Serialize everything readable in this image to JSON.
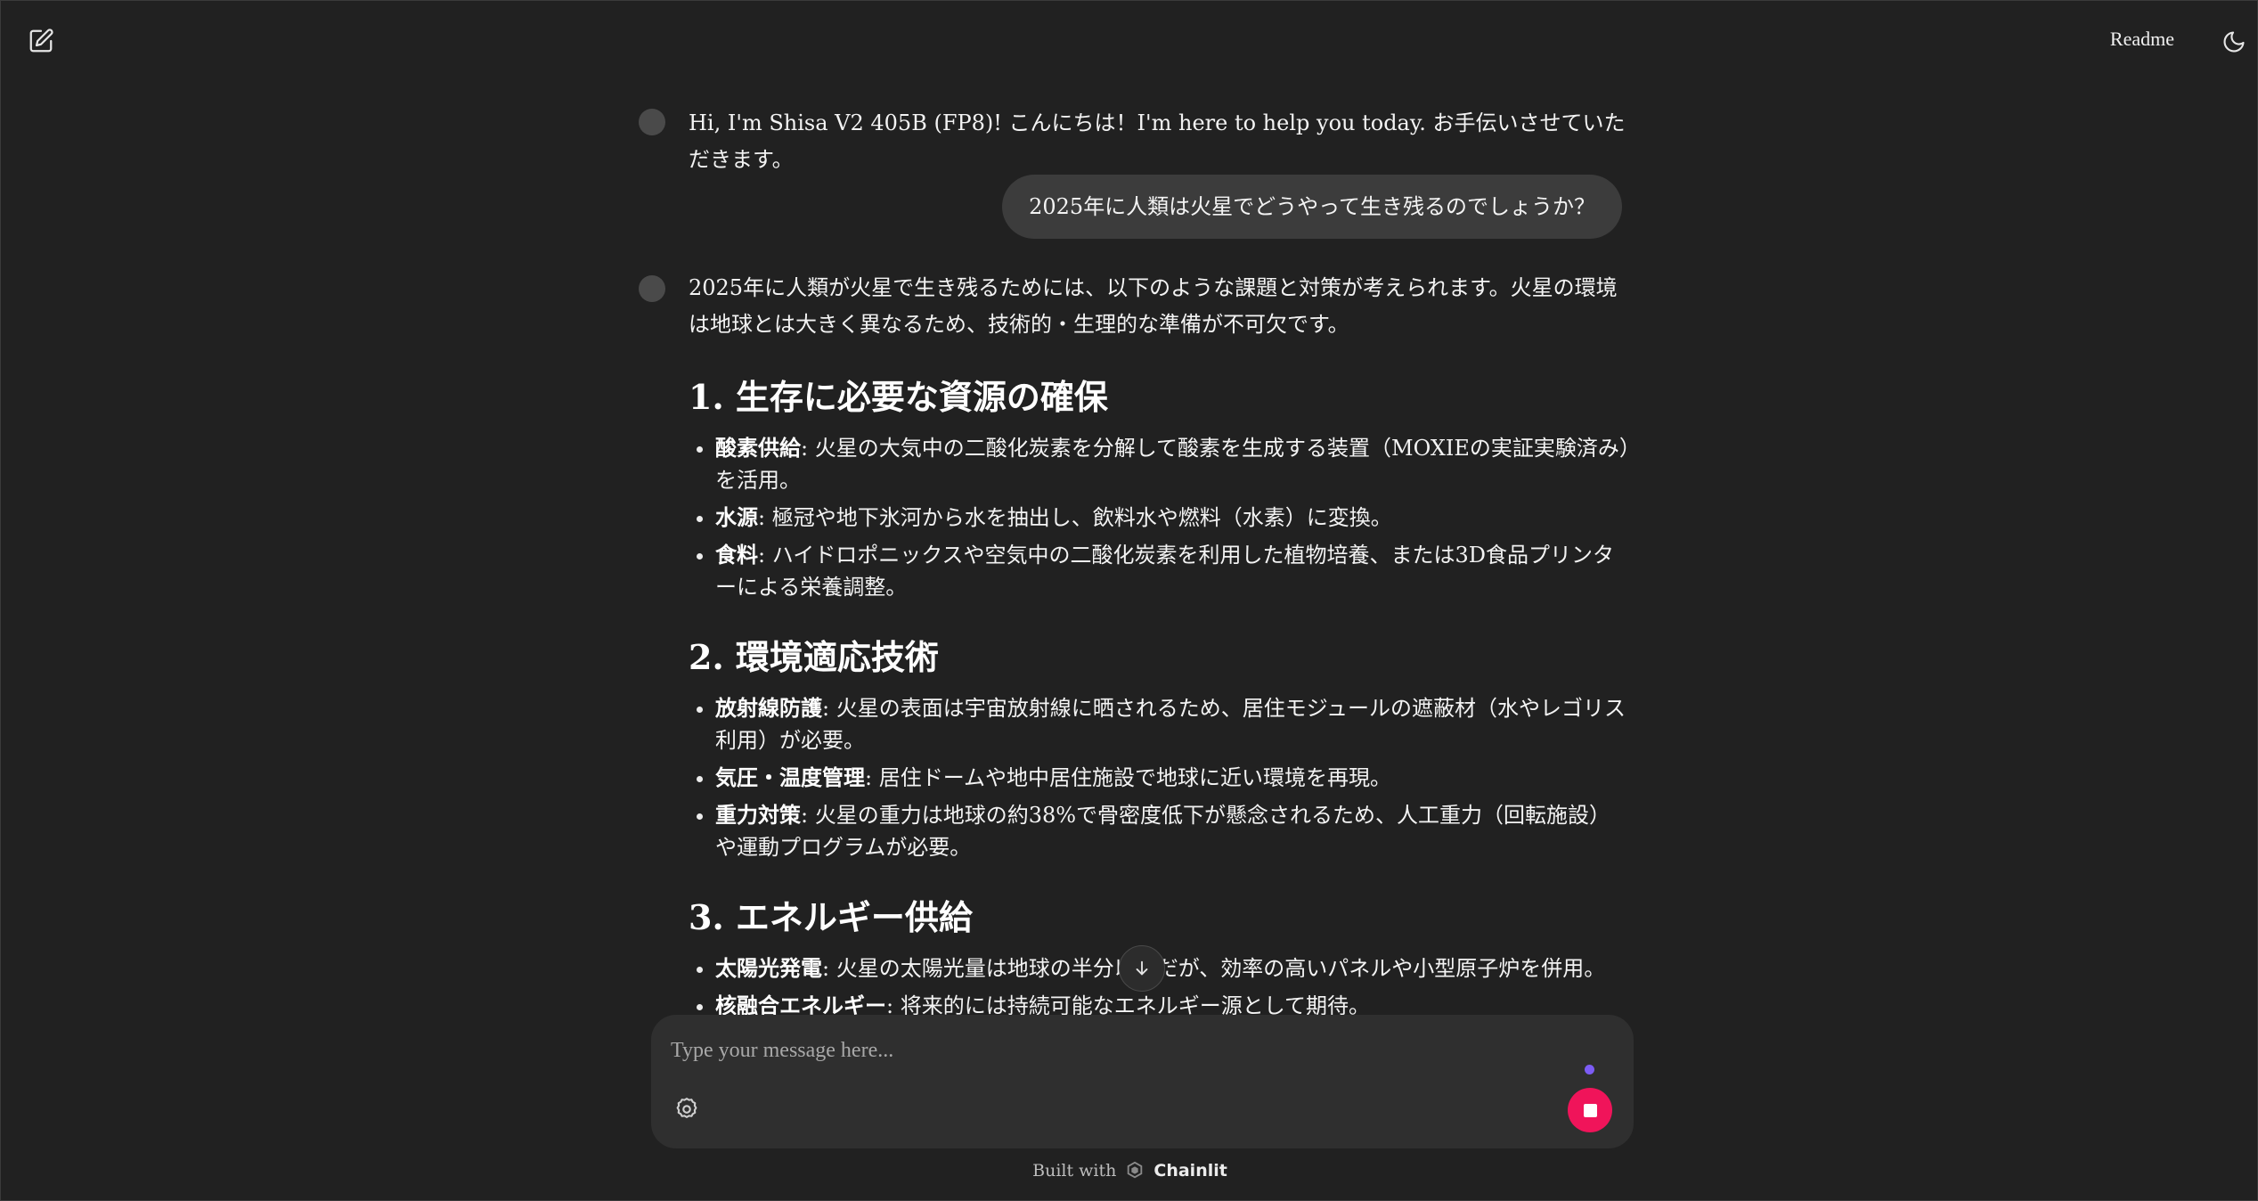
{
  "header": {
    "readme_label": "Readme"
  },
  "messages": {
    "greeting": "Hi, I'm Shisa V2 405B (FP8)! こんにちは！I'm here to help you today. お手伝いさせていただきます。",
    "user_question": "2025年に人類は火星でどうやって生き残るのでしょうか？",
    "answer": {
      "intro": "2025年に人類が火星で生き残るためには、以下のような課題と対策が考えられます。火星の環境は地球とは大きく異なるため、技術的・生理的な準備が不可欠です。",
      "sections": [
        {
          "heading": "1. 生存に必要な資源の確保",
          "items": [
            {
              "term": "酸素供給",
              "text": ": 火星の大気中の二酸化炭素を分解して酸素を生成する装置（MOXIEの実証実験済み）を活用。"
            },
            {
              "term": "水源",
              "text": ": 極冠や地下氷河から水を抽出し、飲料水や燃料（水素）に変換。"
            },
            {
              "term": "食料",
              "text": ": ハイドロポニックスや空気中の二酸化炭素を利用した植物培養、または3D食品プリンターによる栄養調整。"
            }
          ]
        },
        {
          "heading": "2. 環境適応技術",
          "items": [
            {
              "term": "放射線防護",
              "text": ": 火星の表面は宇宙放射線に晒されるため、居住モジュールの遮蔽材（水やレゴリス利用）が必要。"
            },
            {
              "term": "気圧・温度管理",
              "text": ": 居住ドームや地中居住施設で地球に近い環境を再現。"
            },
            {
              "term": "重力対策",
              "text": ": 火星の重力は地球の約38%で骨密度低下が懸念されるため、人工重力（回転施設）や運動プログラムが必要。"
            }
          ]
        },
        {
          "heading": "3. エネルギー供給",
          "items": [
            {
              "term": "太陽光発電",
              "text": ": 火星の太陽光量は地球の半分以下だが、効率の高いパネルや小型原子炉を併用。"
            },
            {
              "term": "核融合エネルギー",
              "text": ": 将来的には持続可能なエネルギー源として期待。"
            }
          ]
        }
      ]
    }
  },
  "composer": {
    "placeholder": "Type your message here..."
  },
  "footer": {
    "built_with": "Built with",
    "brand": "Chainlit"
  },
  "colors": {
    "background": "#212121",
    "bubble": "#3c3c3c",
    "composer": "#2f2f2f",
    "stop_button": "#f0145a",
    "status_dot": "#7c5cf5"
  },
  "icons": {
    "new_chat": "edit-square-icon",
    "theme": "moon-icon",
    "scroll": "arrow-down-icon",
    "settings": "gear-icon",
    "stop": "stop-square-icon",
    "brand": "chainlit-logo-icon"
  }
}
